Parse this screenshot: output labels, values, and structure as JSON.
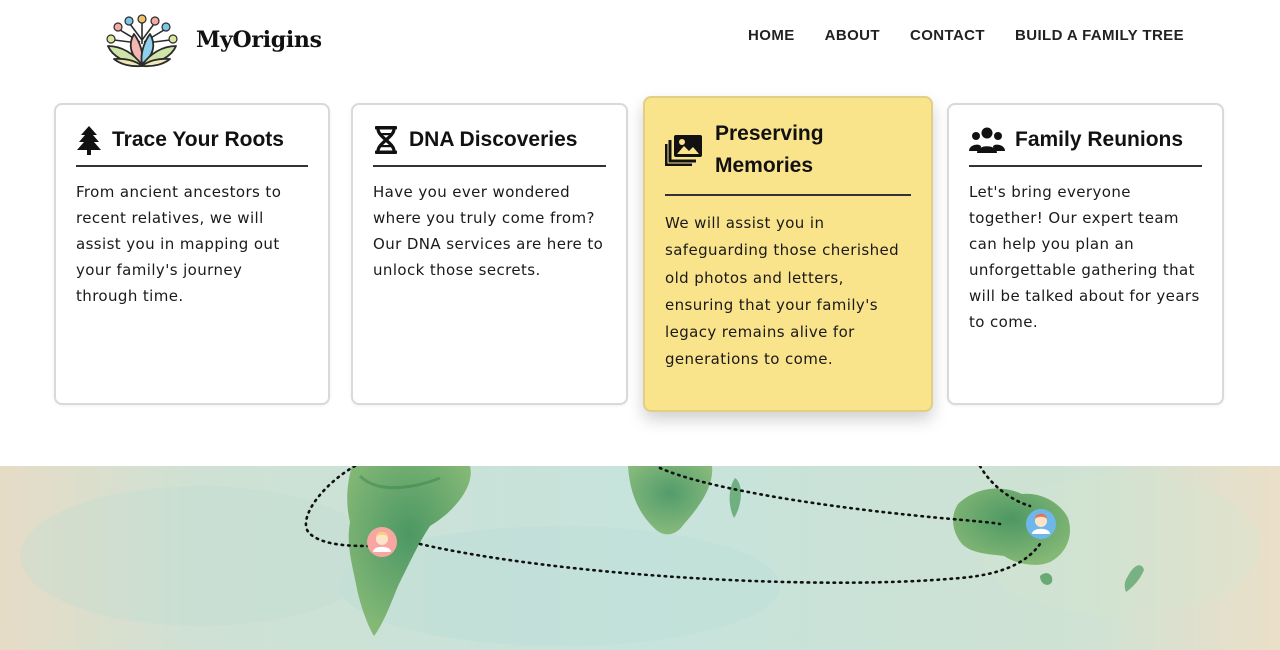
{
  "brand": {
    "name": "MyOrigins",
    "logo_icon": "lotus-family-tree-icon"
  },
  "nav": {
    "items": [
      {
        "label": "HOME"
      },
      {
        "label": "ABOUT"
      },
      {
        "label": "CONTACT"
      },
      {
        "label": "BUILD A FAMILY TREE"
      }
    ]
  },
  "cards": [
    {
      "icon": "tree-icon",
      "title": "Trace Your Roots",
      "text": "From ancient ancestors to recent relatives, we will assist you in mapping out your family's journey through time."
    },
    {
      "icon": "dna-icon",
      "title": "DNA Discoveries",
      "text": "Have you ever wondered where you truly come from? Our DNA services are here to unlock those secrets."
    },
    {
      "icon": "photo-album-icon",
      "title": "Preserving Memories",
      "text": "We will assist you in safeguarding those cherished old photos and letters, ensuring that your family's legacy remains alive for generations to come.",
      "featured": true
    },
    {
      "icon": "group-people-icon",
      "title": "Family Reunions",
      "text": "Let's bring everyone together! Our expert team can help you plan an unforgettable gathering that will be talked about for years to come."
    }
  ],
  "map": {
    "image": "world-map-watercolor",
    "markers": [
      "person-marker-south-america",
      "person-marker-australia"
    ]
  },
  "colors": {
    "featured_card": "#fae48b",
    "card_border": "#d9d9d9",
    "map_water": "#cfe6df",
    "map_land": "#4f9a5a"
  }
}
